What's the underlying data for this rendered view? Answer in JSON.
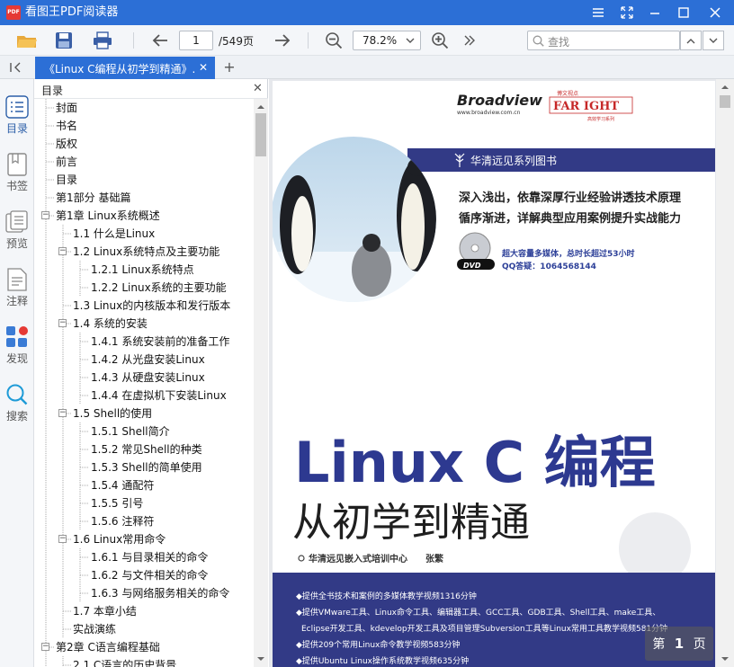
{
  "app": {
    "title": "看图王PDF阅读器",
    "logo_text": "PDF"
  },
  "toolbar": {
    "current_page": "1",
    "total_pages": "/549页",
    "zoom": "78.2%",
    "search_placeholder": "查找"
  },
  "tabs": [
    {
      "label": "《Linux C编程从初学到精通》.(C"
    }
  ],
  "sidebar": {
    "items": [
      {
        "label": "目录"
      },
      {
        "label": "书签"
      },
      {
        "label": "预览"
      },
      {
        "label": "注释"
      },
      {
        "label": "发现"
      },
      {
        "label": "搜索"
      }
    ]
  },
  "toc": {
    "title": "目录",
    "items": [
      {
        "label": "封面",
        "level": 0
      },
      {
        "label": "书名",
        "level": 0
      },
      {
        "label": "版权",
        "level": 0
      },
      {
        "label": "前言",
        "level": 0
      },
      {
        "label": "目录",
        "level": 0
      },
      {
        "label": "第1部分 基础篇",
        "level": 0
      },
      {
        "label": "第1章 Linux系统概述",
        "level": 0,
        "toggle": "−"
      },
      {
        "label": "1.1 什么是Linux",
        "level": 1
      },
      {
        "label": "1.2 Linux系统特点及主要功能",
        "level": 1,
        "toggle": "−"
      },
      {
        "label": "1.2.1 Linux系统特点",
        "level": 2
      },
      {
        "label": "1.2.2 Linux系统的主要功能",
        "level": 2
      },
      {
        "label": "1.3 Linux的内核版本和发行版本",
        "level": 1
      },
      {
        "label": "1.4 系统的安装",
        "level": 1,
        "toggle": "−"
      },
      {
        "label": "1.4.1 系统安装前的准备工作",
        "level": 2
      },
      {
        "label": "1.4.2 从光盘安装Linux",
        "level": 2
      },
      {
        "label": "1.4.3 从硬盘安装Linux",
        "level": 2
      },
      {
        "label": "1.4.4 在虚拟机下安装Linux",
        "level": 2
      },
      {
        "label": "1.5 Shell的使用",
        "level": 1,
        "toggle": "−"
      },
      {
        "label": "1.5.1 Shell简介",
        "level": 2
      },
      {
        "label": "1.5.2 常见Shell的种类",
        "level": 2
      },
      {
        "label": "1.5.3 Shell的简单使用",
        "level": 2
      },
      {
        "label": "1.5.4 通配符",
        "level": 2
      },
      {
        "label": "1.5.5 引号",
        "level": 2
      },
      {
        "label": "1.5.6 注释符",
        "level": 2
      },
      {
        "label": "1.6 Linux常用命令",
        "level": 1,
        "toggle": "−"
      },
      {
        "label": "1.6.1 与目录相关的命令",
        "level": 2
      },
      {
        "label": "1.6.2 与文件相关的命令",
        "level": 2
      },
      {
        "label": "1.6.3 与网络服务相关的命令",
        "level": 2
      },
      {
        "label": "1.7 本章小结",
        "level": 1
      },
      {
        "label": "实战演练",
        "level": 1
      },
      {
        "label": "第2章 C语言编程基础",
        "level": 0,
        "toggle": "−"
      },
      {
        "label": "2.1 C语言的历史背景",
        "level": 1
      }
    ]
  },
  "cover": {
    "publisher": "Broadview",
    "publisher_url": "www.broadview.com.cn",
    "fast_sub": "博文视点",
    "fast_logo": "FAR IGHT",
    "fast_tag": "高效学习系列",
    "series": "华清远见系列图书",
    "slogan1": "深入浅出，依靠深厚行业经验讲透技术原理",
    "slogan2": "循序渐进，详解典型应用案例提升实战能力",
    "dvd": "DVD",
    "dvd_info": "超大容量多媒体，总时长超过53小时",
    "qq": "QQ答疑：1064568144",
    "title_main": "Linux C 编程",
    "title_sub": "从初学到精通",
    "authors": "华清远见嵌入式培训中心",
    "author2": "张繁",
    "bullets": [
      "◆提供全书技术和案例的多媒体教学视频1316分钟",
      "◆提供VMware工具、Linux命令工具、编辑器工具、GCC工具、GDB工具、Shell工具、make工具、",
      "Eclipse开发工具、kdevelop开发工具及项目管理Subversion工具等Linux常用工具教学视频581分钟",
      "◆提供209个常用Linux命令教学视频583分钟",
      "◆提供Ubuntu Linux操作系统教学视频635分钟"
    ]
  },
  "page_indicator": {
    "prefix": "第",
    "num": "1",
    "suffix": "页"
  },
  "colors": {
    "accent": "#2c6fd6",
    "cover_blue": "#323a86"
  }
}
